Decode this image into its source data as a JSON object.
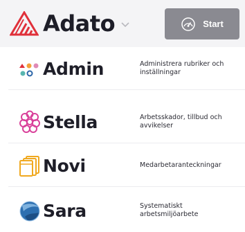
{
  "header": {
    "brand_name": "Adato",
    "brand_logo_icon": "adato-triangle-logo-icon",
    "chevron_icon": "chevron-down-icon",
    "start_label": "Start",
    "start_icon": "speedometer-icon",
    "colors": {
      "header_bg": "#f4f4f6",
      "brand_red": "#e0303a",
      "start_bg": "#8a8a91"
    }
  },
  "apps": [
    {
      "name": "Admin",
      "description": "Administrera rubriker och inställningar",
      "icon": "admin-dots-icon"
    },
    {
      "name": "Stella",
      "description": "Arbetsskador, tillbud och avvikelser",
      "icon": "stella-flower-icon"
    },
    {
      "name": "Novi",
      "description": "Medarbetaranteckningar",
      "icon": "novi-folder-icon"
    },
    {
      "name": "Sara",
      "description": "Systematiskt arbetsmiljöarbete",
      "icon": "sara-globe-icon"
    }
  ]
}
